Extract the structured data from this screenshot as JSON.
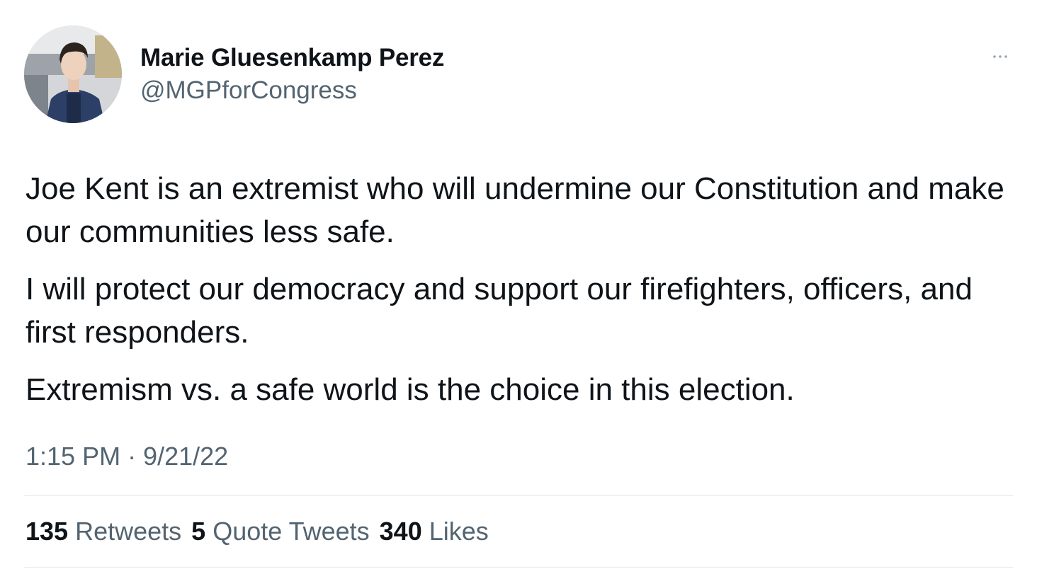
{
  "author": {
    "display_name": "Marie Gluesenkamp Perez",
    "handle": "@MGPforCongress"
  },
  "icons": {
    "more": "more-horizontal-icon",
    "avatar": "profile-photo"
  },
  "tweet": {
    "paragraphs": [
      "Joe Kent is an extremist who will undermine our Constitution and make our communities less safe.",
      "I will protect our democracy and support our firefighters, officers, and first responders.",
      "Extremism vs. a safe world is the choice in this election."
    ],
    "timestamp": "1:15 PM · 9/21/22"
  },
  "stats": {
    "retweets": {
      "count": "135",
      "label": "Retweets"
    },
    "quote_tweets": {
      "count": "5",
      "label": "Quote Tweets"
    },
    "likes": {
      "count": "340",
      "label": "Likes"
    }
  },
  "colors": {
    "text_primary": "#0f1419",
    "text_secondary": "#536471",
    "divider": "#e6e8eb"
  }
}
